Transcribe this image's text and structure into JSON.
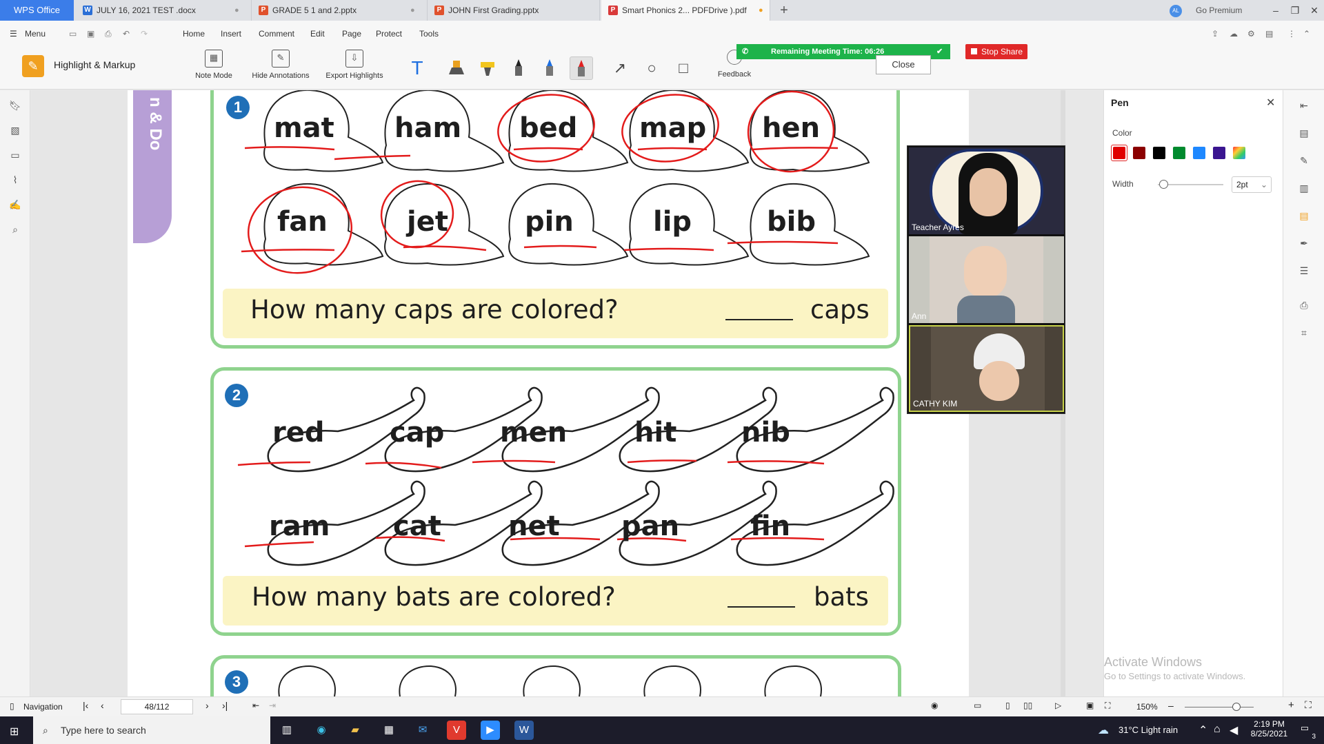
{
  "app": {
    "name": "WPS Office"
  },
  "tabs": [
    {
      "label": "JULY 16, 2021 TEST .docx",
      "type": "W"
    },
    {
      "label": "GRADE 5 1 and 2.pptx",
      "type": "P"
    },
    {
      "label": "JOHN First Grading.pptx",
      "type": "P"
    },
    {
      "label": "Smart Phonics 2... PDFDrive ).pdf",
      "type": "P",
      "active": true
    }
  ],
  "titlebar": {
    "premium": "Go Premium",
    "avatar": "AL"
  },
  "menu": {
    "menu_label": "Menu",
    "items": [
      "Home",
      "Insert",
      "Comment",
      "Edit",
      "Page",
      "Protect",
      "Tools"
    ]
  },
  "markup_toolbar": {
    "title": "Highlight & Markup",
    "note_mode": "Note Mode",
    "hide_annotations": "Hide Annotations",
    "export_highlights": "Export Highlights",
    "text_tool": "T",
    "feedback": "Feedback",
    "close": "Close"
  },
  "meeting": {
    "remaining": "Remaining Meeting Time: 06:26",
    "stop_share": "Stop Share"
  },
  "worksheet": {
    "section1_number": "1",
    "caps_row1": [
      "mat",
      "ham",
      "bed",
      "map",
      "hen"
    ],
    "caps_row2": [
      "fan",
      "jet",
      "pin",
      "lip",
      "bib"
    ],
    "question1": "How many caps are colored?",
    "unit1": "caps",
    "section2_number": "2",
    "bats_row1": [
      "red",
      "cap",
      "men",
      "hit",
      "nib"
    ],
    "bats_row2": [
      "ram",
      "cat",
      "net",
      "pan",
      "fin"
    ],
    "question2": "How many bats are colored?",
    "unit2": "bats",
    "section3_number": "3",
    "side_tab_text": "n & Do"
  },
  "participants": [
    {
      "name": "Teacher Ayres"
    },
    {
      "name": "Ann"
    },
    {
      "name": "CATHY KIM"
    }
  ],
  "pen_panel": {
    "title": "Pen",
    "color_label": "Color",
    "colors": [
      "#e00000",
      "#8b0000",
      "#000000",
      "#008a2e",
      "#1e88ff",
      "#3a1590",
      "rainbow"
    ],
    "width_label": "Width",
    "width_value": "2pt"
  },
  "watermark": {
    "line1": "Activate Windows",
    "line2": "Go to Settings to activate Windows."
  },
  "statusbar": {
    "navigation": "Navigation",
    "page": "48/112",
    "zoom": "150%"
  },
  "taskbar": {
    "search_placeholder": "Type here to search",
    "weather": "31°C  Light rain",
    "time": "2:19 PM",
    "date": "8/25/2021",
    "notifications": "3"
  }
}
